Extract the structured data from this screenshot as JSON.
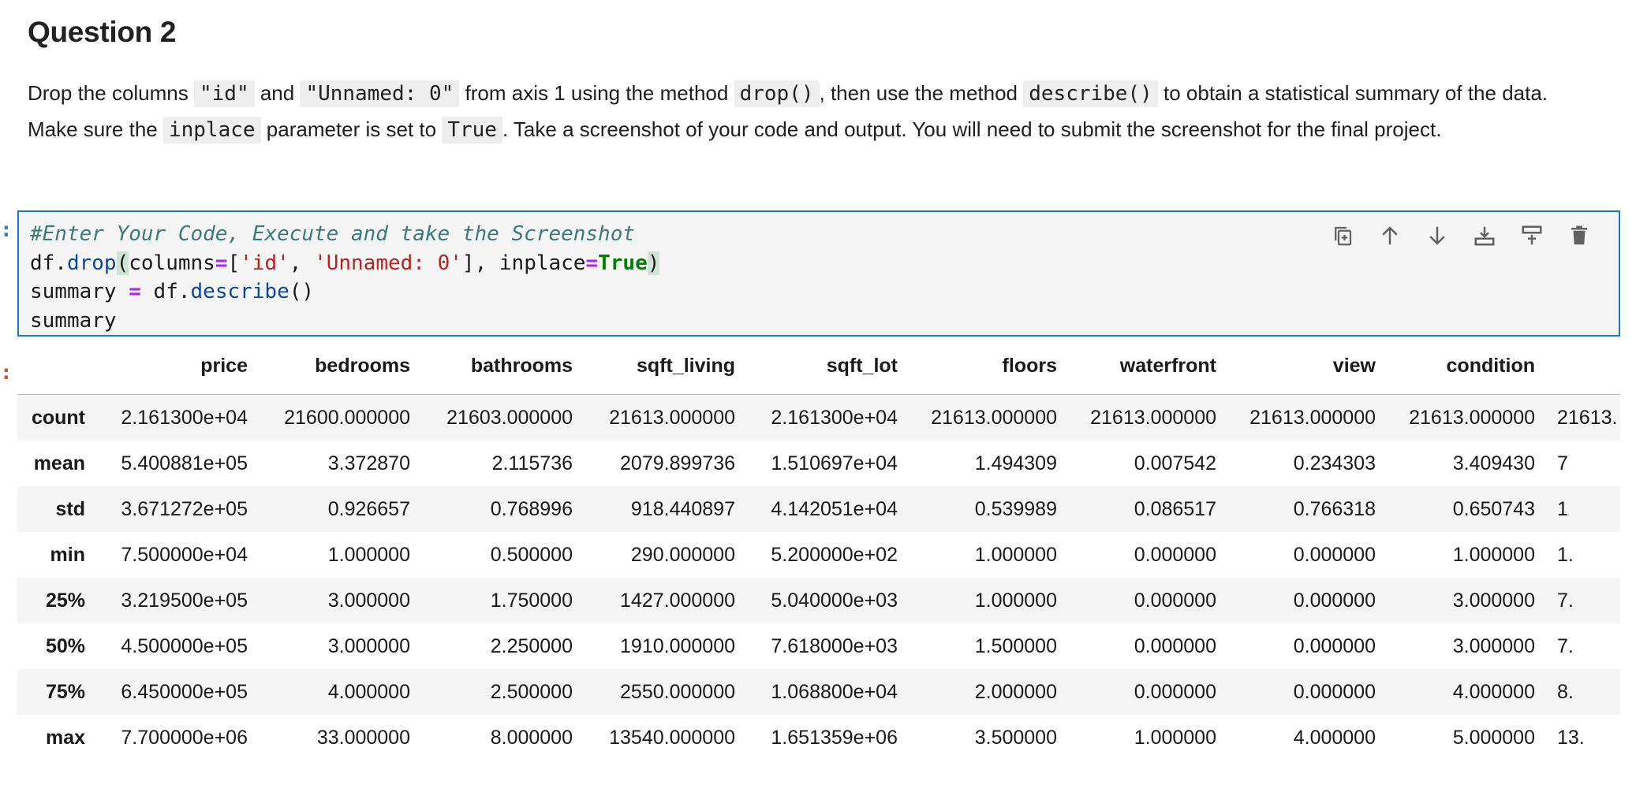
{
  "question": {
    "title": "Question 2",
    "text_1": "Drop the columns ",
    "code_1": "\"id\"",
    "text_2": " and ",
    "code_2": "\"Unnamed: 0\"",
    "text_3": " from axis 1 using the method ",
    "code_3": "drop()",
    "text_4": ", then use the method ",
    "code_4": "describe()",
    "text_5": " to obtain a statistical summary of the data. Make sure the ",
    "code_5": "inplace",
    "text_6": " parameter is set to ",
    "code_6": "True",
    "text_7": ". Take a screenshot of your code and output. You will need to submit the screenshot for the final project."
  },
  "cell": {
    "prompt_in": ":",
    "prompt_out": ":",
    "code": {
      "comment": "#Enter Your Code, Execute and take the Screenshot",
      "l2_a": "df.",
      "l2_fn": "drop",
      "l2_paren_open": "(",
      "l2_b": "columns",
      "l2_eq": "=",
      "l2_br_open": "[",
      "l2_s1": "'id'",
      "l2_comma": ", ",
      "l2_s2": "'Unnamed: 0'",
      "l2_br_close": "]",
      "l2_c": ", inplace",
      "l2_eq2": "=",
      "l2_true": "True",
      "l2_paren_close": ")",
      "l3_a": "summary ",
      "l3_eq": "=",
      "l3_b": " df.",
      "l3_fn": "describe",
      "l3_c": "()",
      "l4": "summary"
    },
    "toolbar": [
      {
        "name": "duplicate-cell-icon"
      },
      {
        "name": "move-up-icon"
      },
      {
        "name": "move-down-icon"
      },
      {
        "name": "insert-below-icon"
      },
      {
        "name": "insert-above-icon"
      },
      {
        "name": "delete-icon"
      }
    ]
  },
  "output": {
    "columns": [
      "price",
      "bedrooms",
      "bathrooms",
      "sqft_living",
      "sqft_lot",
      "floors",
      "waterfront",
      "view",
      "condition",
      ""
    ],
    "rows": [
      {
        "label": "count",
        "values": [
          "2.161300e+04",
          "21600.000000",
          "21603.000000",
          "21613.000000",
          "2.161300e+04",
          "21613.000000",
          "21613.000000",
          "21613.000000",
          "21613.000000",
          "21613."
        ]
      },
      {
        "label": "mean",
        "values": [
          "5.400881e+05",
          "3.372870",
          "2.115736",
          "2079.899736",
          "1.510697e+04",
          "1.494309",
          "0.007542",
          "0.234303",
          "3.409430",
          "7"
        ]
      },
      {
        "label": "std",
        "values": [
          "3.671272e+05",
          "0.926657",
          "0.768996",
          "918.440897",
          "4.142051e+04",
          "0.539989",
          "0.086517",
          "0.766318",
          "0.650743",
          "1"
        ]
      },
      {
        "label": "min",
        "values": [
          "7.500000e+04",
          "1.000000",
          "0.500000",
          "290.000000",
          "5.200000e+02",
          "1.000000",
          "0.000000",
          "0.000000",
          "1.000000",
          "1."
        ]
      },
      {
        "label": "25%",
        "values": [
          "3.219500e+05",
          "3.000000",
          "1.750000",
          "1427.000000",
          "5.040000e+03",
          "1.000000",
          "0.000000",
          "0.000000",
          "3.000000",
          "7."
        ]
      },
      {
        "label": "50%",
        "values": [
          "4.500000e+05",
          "3.000000",
          "2.250000",
          "1910.000000",
          "7.618000e+03",
          "1.500000",
          "0.000000",
          "0.000000",
          "3.000000",
          "7."
        ]
      },
      {
        "label": "75%",
        "values": [
          "6.450000e+05",
          "4.000000",
          "2.500000",
          "2550.000000",
          "1.068800e+04",
          "2.000000",
          "0.000000",
          "0.000000",
          "4.000000",
          "8."
        ]
      },
      {
        "label": "max",
        "values": [
          "7.700000e+06",
          "33.000000",
          "8.000000",
          "13540.000000",
          "1.651359e+06",
          "3.500000",
          "1.000000",
          "4.000000",
          "5.000000",
          "13."
        ]
      }
    ]
  }
}
